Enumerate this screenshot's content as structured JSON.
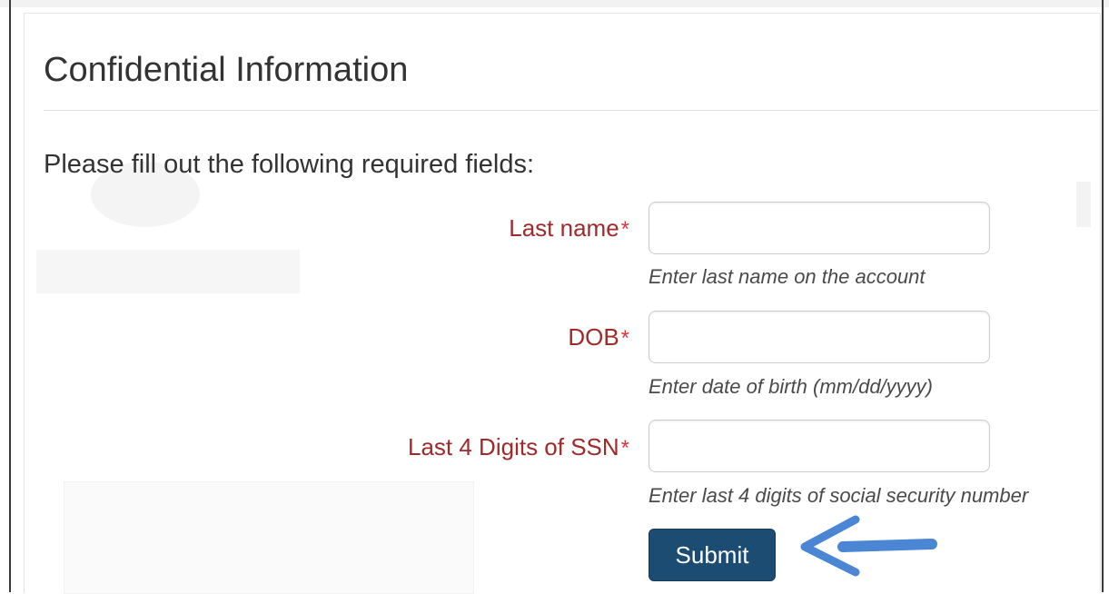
{
  "form": {
    "title": "Confidential Information",
    "instructions": "Please fill out the following required fields:",
    "required_marker": "*",
    "fields": [
      {
        "label": "Last name",
        "value": "",
        "help": "Enter last name on the account"
      },
      {
        "label": "DOB",
        "value": "",
        "help": "Enter date of birth (mm/dd/yyyy)"
      },
      {
        "label": "Last 4 Digits of SSN",
        "value": "",
        "help": "Enter last 4 digits of social security number"
      }
    ],
    "submit_label": "Submit"
  },
  "annotation": {
    "icon": "arrow-left-icon",
    "color": "#4a86d4"
  },
  "colors": {
    "label": "#a02a2a",
    "required": "#d9373f",
    "button": "#1d4c72"
  }
}
